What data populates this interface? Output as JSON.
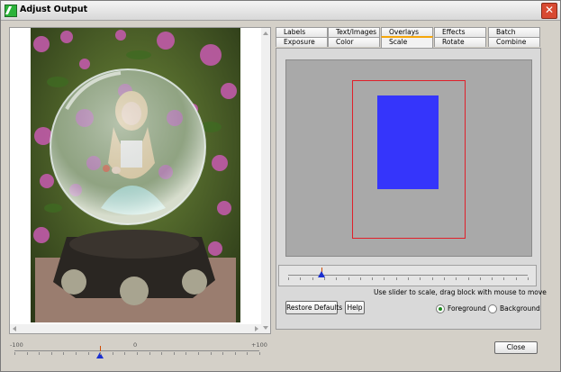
{
  "window": {
    "title": "Adjust Output",
    "close_glyph": "✕",
    "icon": "app-logo-icon"
  },
  "preview_image": {
    "description_icon": "photo-preview"
  },
  "tabs": {
    "row1": [
      {
        "label": "Labels"
      },
      {
        "label": "Text/Images"
      },
      {
        "label": "Overlays"
      },
      {
        "label": "Effects"
      },
      {
        "label": "Batch"
      }
    ],
    "row2": [
      {
        "label": "Exposure"
      },
      {
        "label": "Color"
      },
      {
        "label": "Scale",
        "active": true
      },
      {
        "label": "Rotate"
      },
      {
        "label": "Combine"
      }
    ]
  },
  "scale_tab": {
    "slider_value": 0.14,
    "hint": "Use slider to scale,  drag block with mouse to move",
    "restore_label": "Restore Defaults",
    "help_label": "Help",
    "radio_foreground": "Foreground",
    "radio_background": "Background",
    "selected": "Foreground",
    "frame_color": "#e0202a",
    "block_color": "#3535fb"
  },
  "bottom_slider": {
    "min_label": "-100",
    "mid_label": "0",
    "max_label": "+100",
    "value": -30
  },
  "footer": {
    "close_label": "Close"
  }
}
